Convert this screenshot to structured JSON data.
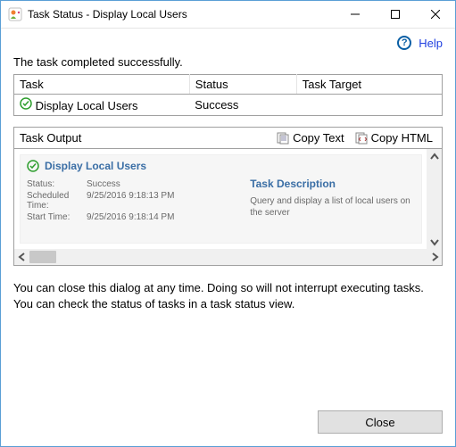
{
  "titlebar": {
    "title": "Task Status - Display Local Users"
  },
  "help": {
    "label": "Help"
  },
  "message": "The task completed successfully.",
  "table": {
    "headers": {
      "task": "Task",
      "status": "Status",
      "target": "Task Target"
    },
    "rows": [
      {
        "task": "Display Local Users",
        "status": "Success",
        "target": ""
      }
    ]
  },
  "output": {
    "label": "Task Output",
    "copy_text": "Copy Text",
    "copy_html": "Copy HTML",
    "card": {
      "title": "Display Local Users",
      "status_label": "Status:",
      "status_value": "Success",
      "scheduled_label": "Scheduled Time:",
      "scheduled_value": "9/25/2016 9:18:13 PM",
      "start_label": "Start Time:",
      "start_value": "9/25/2016 9:18:14 PM",
      "desc_title": "Task Description",
      "desc_text": "Query and display a list of local users on the server"
    }
  },
  "footer_note": "You can close this dialog at any time. Doing so will not interrupt executing tasks. You can check the status of tasks in a task status view.",
  "buttons": {
    "close": "Close"
  }
}
